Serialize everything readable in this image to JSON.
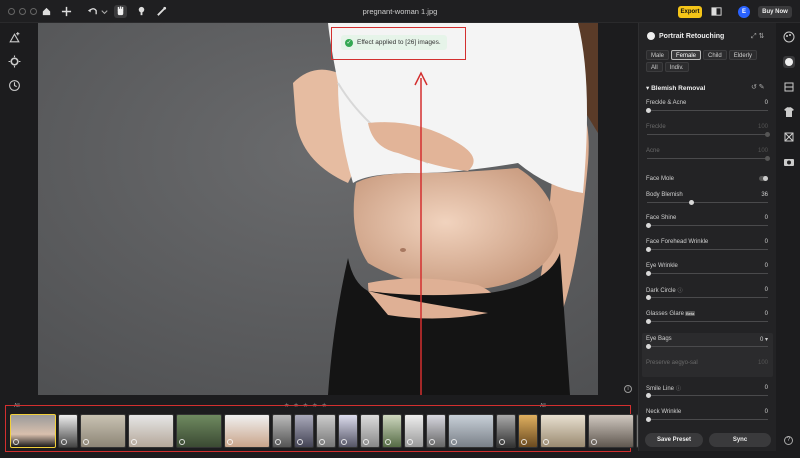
{
  "window": {
    "title": "pregnant-woman 1.jpg"
  },
  "topbar": {
    "export_label": "Export",
    "avatar_letter": "E",
    "buy_label": "Buy Now",
    "export_color": "#f5c518",
    "avatar_color": "#2962ff"
  },
  "toast": {
    "message": "Effect applied to [26] images.",
    "check": "✓"
  },
  "filmstrip": {
    "left_label": "All",
    "right_label": "All",
    "stars": "★★★★★",
    "thumbs": 26
  },
  "panel": {
    "title": "Portrait Retouching",
    "segments": [
      "Male",
      "Female",
      "Child",
      "Elderly",
      "All",
      "Indiv."
    ],
    "active_segment": "Female",
    "section": "Blemish Removal",
    "rows": {
      "freckle": {
        "label": "Freckle & Acne",
        "value": "0"
      },
      "freckle_sub": {
        "label": "Freckle",
        "value": "100"
      },
      "acne_sub": {
        "label": "Acne",
        "value": "100"
      },
      "face_mole": {
        "label": "Face Mole"
      },
      "body_blemish": {
        "label": "Body Blemish",
        "value": "36"
      },
      "face_shine": {
        "label": "Face Shine",
        "value": "0"
      },
      "forehead": {
        "label": "Face Forehead Wrinkle",
        "value": "0"
      },
      "eye_wrinkle": {
        "label": "Eye Wrinkle",
        "value": "0"
      },
      "dark_circle": {
        "label": "Dark Circle",
        "value": "0"
      },
      "glasses_glare": {
        "label": "Glasses Glare",
        "badge": "Beta",
        "value": "0"
      },
      "eye_bags": {
        "label": "Eye Bags",
        "value": "0"
      },
      "preserve": {
        "label": "Preserve aegyo-sal",
        "value": "100"
      },
      "smile_line": {
        "label": "Smile Line",
        "value": "0"
      },
      "neck_wrinkle": {
        "label": "Neck Wrinkle",
        "value": "0"
      }
    },
    "save_preset": "Save Preset",
    "sync": "Sync"
  },
  "icons": {
    "home": "home-icon",
    "add": "plus-icon",
    "undo": "undo-icon",
    "hand": "hand-icon",
    "stamp": "stamp-icon",
    "brush": "brush-icon"
  }
}
